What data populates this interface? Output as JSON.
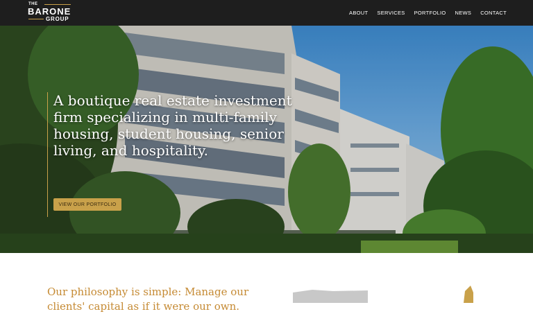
{
  "header": {
    "logo": {
      "the": "THE",
      "barone": "BARONE",
      "group": "GROUP"
    },
    "nav": [
      "ABOUT",
      "SERVICES",
      "PORTFOLIO",
      "NEWS",
      "CONTACT"
    ]
  },
  "hero": {
    "headline": "A boutique real estate investment firm specializing in multi-family housing, student housing, senior living, and hospitality.",
    "cta": "VIEW OUR PORTFOLIO"
  },
  "philosophy": {
    "text": "Our philosophy is simple: Manage our clients' capital as if it were our own."
  },
  "colors": {
    "accent": "#c9a14a",
    "header": "#1e1e1e",
    "philosophy_text": "#c58a33"
  }
}
